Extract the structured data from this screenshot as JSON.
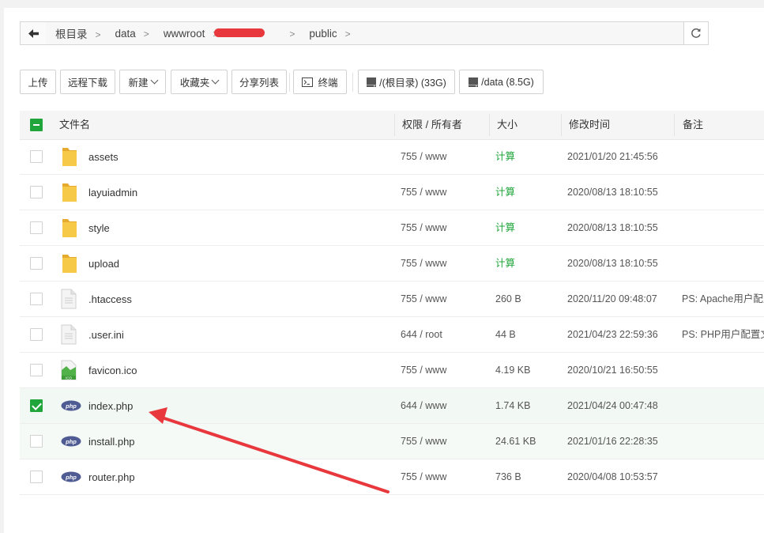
{
  "breadcrumb": {
    "items": [
      "根目录",
      "data",
      "wwwroot",
      "",
      "public"
    ]
  },
  "toolbar": {
    "upload": "上传",
    "remote_download": "远程下载",
    "new": "新建",
    "favorites": "收藏夹",
    "share_list": "分享列表",
    "terminal": "终端",
    "disk_root": "/(根目录) (33G)",
    "disk_data": "/data (8.5G)"
  },
  "table": {
    "columns": {
      "name": "文件名",
      "perm": "权限 / 所有者",
      "size": "大小",
      "mtime": "修改时间",
      "note": "备注"
    },
    "rows": [
      {
        "name": "assets",
        "type": "folder",
        "perm": "755 / www",
        "size": "计算",
        "mtime": "2021/01/20 21:45:56",
        "note": "",
        "checked": false
      },
      {
        "name": "layuiadmin",
        "type": "folder",
        "perm": "755 / www",
        "size": "计算",
        "mtime": "2020/08/13 18:10:55",
        "note": "",
        "checked": false
      },
      {
        "name": "style",
        "type": "folder",
        "perm": "755 / www",
        "size": "计算",
        "mtime": "2020/08/13 18:10:55",
        "note": "",
        "checked": false
      },
      {
        "name": "upload",
        "type": "folder",
        "perm": "755 / www",
        "size": "计算",
        "mtime": "2020/08/13 18:10:55",
        "note": "",
        "checked": false
      },
      {
        "name": ".htaccess",
        "type": "text",
        "perm": "755 / www",
        "size": "260 B",
        "mtime": "2020/11/20 09:48:07",
        "note": "PS: Apache用户配置",
        "checked": false
      },
      {
        "name": ".user.ini",
        "type": "text",
        "perm": "644 / root",
        "size": "44 B",
        "mtime": "2021/04/23 22:59:36",
        "note": "PS: PHP用户配置文",
        "checked": false
      },
      {
        "name": "favicon.ico",
        "type": "image",
        "perm": "755 / www",
        "size": "4.19 KB",
        "mtime": "2020/10/21 16:50:55",
        "note": "",
        "checked": false
      },
      {
        "name": "index.php",
        "type": "php",
        "perm": "644 / www",
        "size": "1.74 KB",
        "mtime": "2021/04/24 00:47:48",
        "note": "",
        "checked": true
      },
      {
        "name": "install.php",
        "type": "php",
        "perm": "755 / www",
        "size": "24.61 KB",
        "mtime": "2021/01/16 22:28:35",
        "note": "",
        "checked": false
      },
      {
        "name": "router.php",
        "type": "php",
        "perm": "755 / www",
        "size": "736 B",
        "mtime": "2020/04/08 10:53:57",
        "note": "",
        "checked": false
      }
    ]
  },
  "icons": {
    "folder": "folder-icon",
    "text": "text-file-icon",
    "image": "ico-image-icon",
    "php": "php-file-icon",
    "php_badge": "php",
    "ico_badge": "ICO"
  },
  "colors": {
    "accent": "#20a53a",
    "folder": "#f5c242",
    "php_badge": "#4f5b93",
    "annotation_arrow": "#e8383d"
  }
}
